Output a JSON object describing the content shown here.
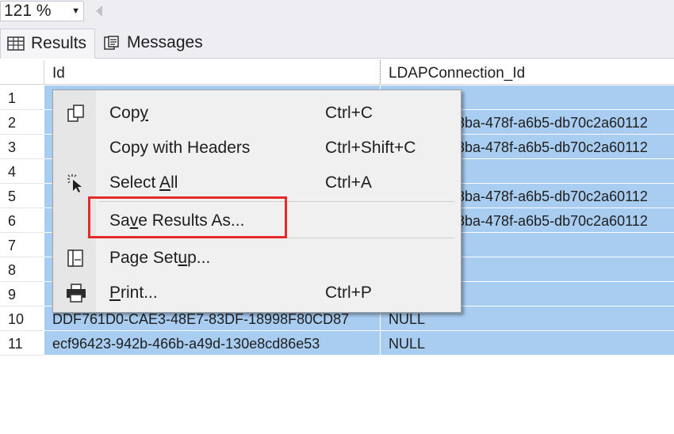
{
  "toolbar": {
    "zoom_value": "121 %",
    "zoom_arrow": "▼"
  },
  "tabs": [
    {
      "label": "Results",
      "icon": "grid-icon"
    },
    {
      "label": "Messages",
      "icon": "messages-icon"
    }
  ],
  "grid": {
    "columns": [
      "Id",
      "LDAPConnection_Id"
    ],
    "rows": [
      {
        "no": "1",
        "id": "",
        "ldap": ""
      },
      {
        "no": "2",
        "id": "",
        "ldap": "a8ba-478f-a6b5-db70c2a60112"
      },
      {
        "no": "3",
        "id": "",
        "ldap": "a8ba-478f-a6b5-db70c2a60112"
      },
      {
        "no": "4",
        "id": "",
        "ldap": ""
      },
      {
        "no": "5",
        "id": "",
        "ldap": "a8ba-478f-a6b5-db70c2a60112"
      },
      {
        "no": "6",
        "id": "",
        "ldap": "a8ba-478f-a6b5-db70c2a60112"
      },
      {
        "no": "7",
        "id": "",
        "ldap": ""
      },
      {
        "no": "8",
        "id": "",
        "ldap": ""
      },
      {
        "no": "9",
        "id": "",
        "ldap": ""
      },
      {
        "no": "10",
        "id": "DDF761D0-CAE3-48E7-83DF-18998F80CD87",
        "ldap": "NULL"
      },
      {
        "no": "11",
        "id": "ecf96423-942b-466b-a49d-130e8cd86e53",
        "ldap": "NULL"
      }
    ]
  },
  "context_menu": {
    "items": [
      {
        "label_pre": "Cop",
        "label_u": "y",
        "label_post": "",
        "shortcut": "Ctrl+C",
        "icon": "copy-icon"
      },
      {
        "label_pre": "Copy with Headers",
        "label_u": "",
        "label_post": "",
        "shortcut": "Ctrl+Shift+C",
        "icon": ""
      },
      {
        "label_pre": "Select ",
        "label_u": "A",
        "label_post": "ll",
        "shortcut": "Ctrl+A",
        "icon": "select-all-icon"
      },
      {
        "label_pre": "Sa",
        "label_u": "v",
        "label_post": "e Results As...",
        "shortcut": "",
        "icon": ""
      },
      {
        "label_pre": "Page Set",
        "label_u": "u",
        "label_post": "p...",
        "shortcut": "",
        "icon": "page-setup-icon"
      },
      {
        "label_pre": "",
        "label_u": "P",
        "label_post": "rint...",
        "shortcut": "Ctrl+P",
        "icon": "printer-icon"
      }
    ]
  },
  "colors": {
    "selection": "#a8cdf0",
    "highlight": "#e52a2a"
  }
}
